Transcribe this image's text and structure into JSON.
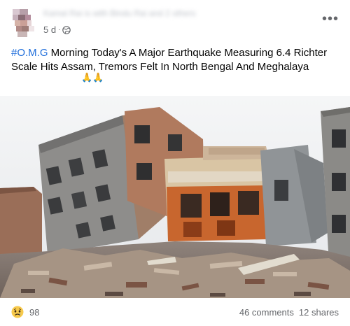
{
  "post": {
    "author_name": "Kamal Rai is with Bindu Rai and 2 others",
    "time": "5 d",
    "separator": "·",
    "visibility_icon": "globe-icon",
    "more_icon": "more-options-icon",
    "hashtag": "#O.M.G",
    "text": " Morning Today's A Major Earthquake Measuring 6.4 Richter Scale Hits Assam, Tremors Felt In North Bengal And Meghalaya",
    "emoji": "🙏🙏",
    "image_description_icon": "photo"
  },
  "footer": {
    "reaction_icon": "sad-reaction-icon",
    "reaction_count": "98",
    "comments": "46 comments",
    "shares": "12 shares"
  },
  "colors": {
    "link": "#216fdb",
    "secondary_text": "#65676b",
    "primary_text": "#050505"
  }
}
